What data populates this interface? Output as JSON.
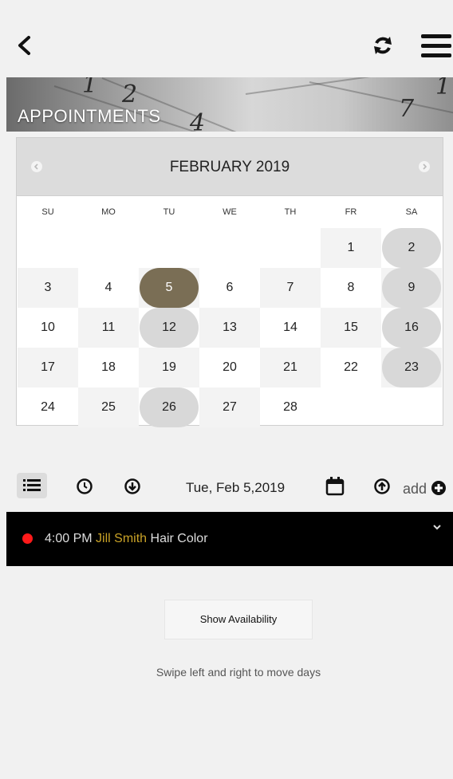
{
  "header": {
    "back_icon": "chevron-left-icon",
    "refresh_icon": "refresh-icon",
    "menu_icon": "hamburger-menu-icon"
  },
  "banner": {
    "title": "APPOINTMENTS"
  },
  "calendar": {
    "month_label": "FEBRUARY 2019",
    "weekdays": [
      "SU",
      "MO",
      "TU",
      "WE",
      "TH",
      "FR",
      "SA"
    ],
    "days": [
      "1",
      "2",
      "3",
      "4",
      "5",
      "6",
      "7",
      "8",
      "9",
      "10",
      "11",
      "12",
      "13",
      "14",
      "15",
      "16",
      "17",
      "18",
      "19",
      "20",
      "21",
      "22",
      "23",
      "24",
      "25",
      "26",
      "27",
      "28"
    ],
    "selected_day": "5",
    "highlighted_days": [
      "2",
      "9",
      "12",
      "16",
      "23",
      "26"
    ],
    "colors": {
      "selected": "#7a6e55",
      "highlight": "#d8d8d8"
    }
  },
  "toolbar": {
    "date_label": "Tue, Feb 5,2019",
    "add_label": "add",
    "icons": [
      "list-icon",
      "clock-icon",
      "down-circle-icon",
      "calendar-icon",
      "up-circle-icon",
      "plus-circle-icon"
    ]
  },
  "appointment": {
    "time": "4:00 PM",
    "client": "Jill Smith",
    "service": "Hair Color",
    "status_color": "#ff1a1a"
  },
  "actions": {
    "show_availability": "Show Availability"
  },
  "hint": "Swipe left and right to move days"
}
